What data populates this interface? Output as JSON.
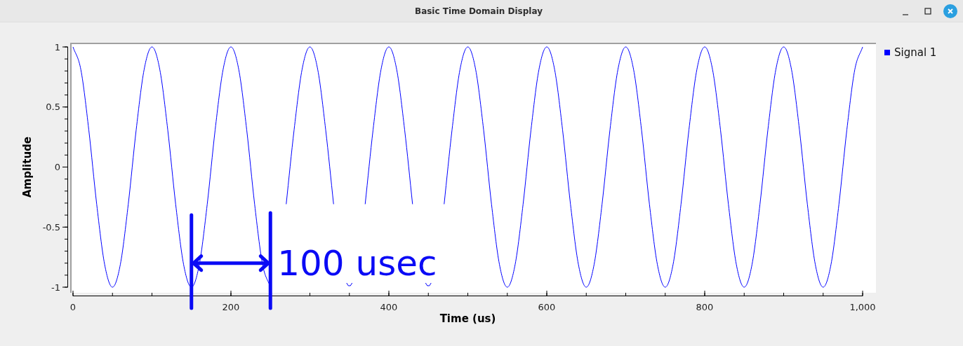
{
  "window": {
    "title": "Basic Time Domain Display"
  },
  "plot": {
    "chart_data": {
      "type": "line",
      "xlabel": "Time (us)",
      "ylabel": "Amplitude",
      "x": [
        0,
        10,
        20,
        30,
        40,
        50,
        60,
        70,
        80,
        90,
        100,
        110,
        120,
        130,
        140,
        150,
        160,
        170,
        180,
        190,
        200,
        210,
        220,
        230,
        240,
        250,
        260,
        270,
        280,
        290,
        300,
        310,
        320,
        330,
        340,
        350,
        360,
        370,
        380,
        390,
        400,
        410,
        420,
        430,
        440,
        450,
        460,
        470,
        480,
        490,
        500,
        510,
        520,
        530,
        540,
        550,
        560,
        570,
        580,
        590,
        600,
        610,
        620,
        630,
        640,
        650,
        660,
        670,
        680,
        690,
        700,
        710,
        720,
        730,
        740,
        750,
        760,
        770,
        780,
        790,
        800,
        810,
        820,
        830,
        840,
        850,
        860,
        870,
        880,
        890,
        900,
        910,
        920,
        930,
        940,
        950,
        960,
        970,
        980,
        990,
        1000
      ],
      "series": [
        {
          "name": "Signal 1",
          "color": "#0000ff",
          "values": [
            1,
            0.809,
            0.309,
            -0.309,
            -0.809,
            -1,
            -0.809,
            -0.309,
            0.309,
            0.809,
            1,
            0.809,
            0.309,
            -0.309,
            -0.809,
            -1,
            -0.809,
            -0.309,
            0.309,
            0.809,
            1,
            0.809,
            0.309,
            -0.309,
            -0.809,
            -1,
            null,
            -0.309,
            0.309,
            0.809,
            1,
            0.809,
            0.309,
            -0.309,
            null,
            -0.988,
            null,
            -0.309,
            0.309,
            0.809,
            1,
            0.809,
            0.309,
            -0.309,
            null,
            -0.988,
            null,
            -0.309,
            0.309,
            0.809,
            1,
            0.809,
            0.309,
            -0.309,
            -0.809,
            -1,
            -0.809,
            -0.309,
            0.309,
            0.809,
            1,
            0.809,
            0.309,
            -0.309,
            -0.809,
            -1,
            -0.809,
            -0.309,
            0.309,
            0.809,
            1,
            0.809,
            0.309,
            -0.309,
            -0.809,
            -1,
            -0.809,
            -0.309,
            0.309,
            0.809,
            1,
            0.809,
            0.309,
            -0.309,
            -0.809,
            -1,
            -0.809,
            -0.309,
            0.309,
            0.809,
            1,
            0.809,
            0.309,
            -0.309,
            -0.809,
            -1,
            -0.809,
            -0.309,
            0.309,
            0.809,
            1
          ]
        }
      ],
      "xlim": [
        0,
        1000
      ],
      "ylim": [
        -1,
        1
      ],
      "xticks": [
        0,
        200,
        400,
        600,
        800,
        {
          "value": 1000,
          "label": "1,000"
        }
      ],
      "yticks": [
        -1,
        -0.5,
        0,
        0.5,
        1
      ],
      "ref_lines": [
        {
          "value": 150,
          "axis": "x"
        },
        {
          "value": 250,
          "axis": "x"
        }
      ],
      "annotations": [
        "100 usec"
      ]
    }
  }
}
